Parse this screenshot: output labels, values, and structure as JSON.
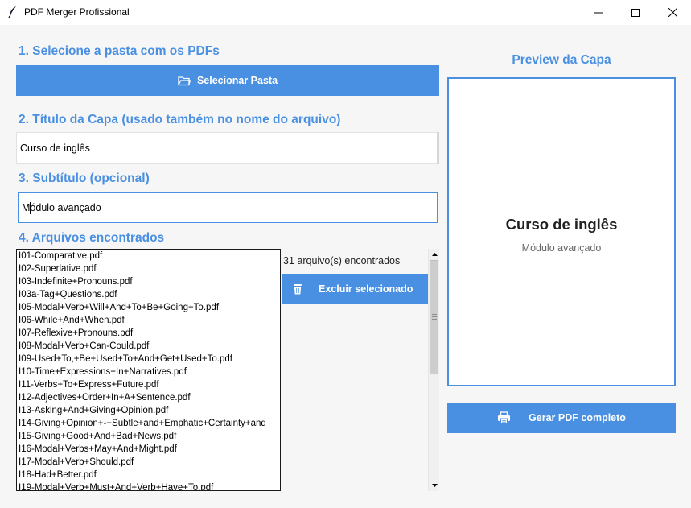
{
  "window": {
    "title": "PDF Merger Profissional"
  },
  "step1": {
    "heading": "1. Selecione a pasta com os PDFs",
    "button_label": "Selecionar Pasta",
    "button_icon": "folder-icon"
  },
  "step2": {
    "heading": "2. Título da Capa (usado também no nome do arquivo)",
    "value": "Curso de inglês"
  },
  "step3": {
    "heading": "3. Subtítulo (opcional)",
    "value": "Módulo avançado"
  },
  "step4": {
    "heading": "4. Arquivos encontrados",
    "count_label": "31 arquivo(s) encontrados",
    "delete_button_label": "Excluir selecionado",
    "delete_button_icon": "trash-icon",
    "files": [
      "I01-Comparative.pdf",
      "I02-Superlative.pdf",
      "I03-Indefinite+Pronouns.pdf",
      "I03a-Tag+Questions.pdf",
      "I05-Modal+Verb+Will+And+To+Be+Going+To.pdf",
      "I06-While+And+When.pdf",
      "I07-Reflexive+Pronouns.pdf",
      "I08-Modal+Verb+Can-Could.pdf",
      "I09-Used+To,+Be+Used+To+And+Get+Used+To.pdf",
      "I10-Time+Expressions+In+Narratives.pdf",
      "I11-Verbs+To+Express+Future.pdf",
      "I12-Adjectives+Order+In+A+Sentence.pdf",
      "I13-Asking+And+Giving+Opinion.pdf",
      "I14-Giving+Opinion+-+Subtle+and+Emphatic+Certainty+and",
      "I15-Giving+Good+And+Bad+News.pdf",
      "I16-Modal+Verbs+May+And+Might.pdf",
      "I17-Modal+Verb+Should.pdf",
      "I18-Had+Better.pdf",
      "I19-Modal+Verb+Must+And+Verb+Have+To.pdf"
    ]
  },
  "preview": {
    "heading": "Preview da Capa",
    "cover_title": "Curso de inglês",
    "cover_subtitle": "Módulo avançado"
  },
  "generate": {
    "button_label": "Gerar PDF completo",
    "button_icon": "printer-icon"
  },
  "colors": {
    "accent": "#4a90e2",
    "background": "#f6f6f6"
  }
}
